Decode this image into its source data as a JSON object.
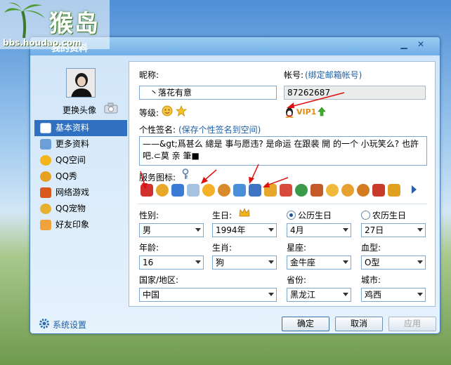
{
  "watermark": {
    "title": "猴岛",
    "url": "bbs.houdao.com"
  },
  "window": {
    "title": "我的资料"
  },
  "sidebar": {
    "change_avatar": "更换头像",
    "items": [
      {
        "label": "基本资料",
        "icon": "id-card-icon",
        "color": "#3d7dcf"
      },
      {
        "label": "更多资料",
        "icon": "document-icon",
        "color": "#6b9fd6"
      },
      {
        "label": "QQ空间",
        "icon": "qzone-star-icon",
        "color": "#f2b51c"
      },
      {
        "label": "QQ秀",
        "icon": "qq-show-icon",
        "color": "#e6a020"
      },
      {
        "label": "网络游戏",
        "icon": "game-icon",
        "color": "#d9581e"
      },
      {
        "label": "QQ宠物",
        "icon": "pet-icon",
        "color": "#e8b030"
      },
      {
        "label": "好友印象",
        "icon": "impression-icon",
        "color": "#f0a23c"
      }
    ],
    "settings": "系统设置"
  },
  "profile": {
    "nickname_label": "昵称:",
    "nickname_value": "丶落花有意",
    "account_label": "帐号:",
    "account_bind": "(绑定邮箱帐号)",
    "account_value": "87262687",
    "level_label": "等级:",
    "vip_text": "VIP1",
    "signature_label": "个性签名:",
    "signature_link": "(保存个性签名到空间)",
    "signature_value": "——&gt;爲甚么 總是 事与愿违? 是命运 在跟裴 開 的一个 小玩笑么? 也許吧.⊂莫 亲 筆■",
    "service_label": "服务图标:"
  },
  "service_icons": [
    {
      "name": "qq-penguin-icon",
      "color": "#d22f2f"
    },
    {
      "name": "qzone-icon",
      "color": "#e8a92b"
    },
    {
      "name": "shield-icon",
      "color": "#3a7bd5"
    },
    {
      "name": "mail-icon",
      "color": "#a7c2e0"
    },
    {
      "name": "pet-icon",
      "color": "#f5b02a"
    },
    {
      "name": "music-icon",
      "color": "#d98a2b"
    },
    {
      "name": "phone-icon",
      "color": "#4a8fd8"
    },
    {
      "name": "mobile-qq-icon",
      "color": "#3e74c2"
    },
    {
      "name": "notes-icon",
      "color": "#e6a72a"
    },
    {
      "name": "photo-icon",
      "color": "#d84a3a"
    },
    {
      "name": "tencent-logo-icon",
      "color": "#3a9a4a"
    },
    {
      "name": "video-icon",
      "color": "#c45a2a"
    },
    {
      "name": "cat-game-icon",
      "color": "#f0b93a"
    },
    {
      "name": "face-icon",
      "color": "#e8a030"
    },
    {
      "name": "lucky-icon",
      "color": "#d47a20"
    },
    {
      "name": "fun-icon",
      "color": "#c83a2a"
    },
    {
      "name": "tools-icon",
      "color": "#e0a020"
    }
  ],
  "fields": {
    "gender": {
      "label": "性别:",
      "value": "男"
    },
    "birthday": {
      "label": "生日:",
      "year": "1994年",
      "month": "4月",
      "day": "27日"
    },
    "solar": "公历生日",
    "lunar": "农历生日",
    "age": {
      "label": "年龄:",
      "value": "16"
    },
    "zodiac": {
      "label": "生肖:",
      "value": "狗"
    },
    "constellation": {
      "label": "星座:",
      "value": "金牛座"
    },
    "blood": {
      "label": "血型:",
      "value": "O型"
    },
    "country": {
      "label": "国家/地区:",
      "value": "中国"
    },
    "province": {
      "label": "省份:",
      "value": "黑龙江"
    },
    "city": {
      "label": "城市:",
      "value": "鸡西"
    }
  },
  "buttons": {
    "ok": "确定",
    "cancel": "取消",
    "apply": "应用"
  },
  "colors": {
    "accent": "#3070c0",
    "link": "#1f5fa8",
    "annotation": "#e01010"
  }
}
